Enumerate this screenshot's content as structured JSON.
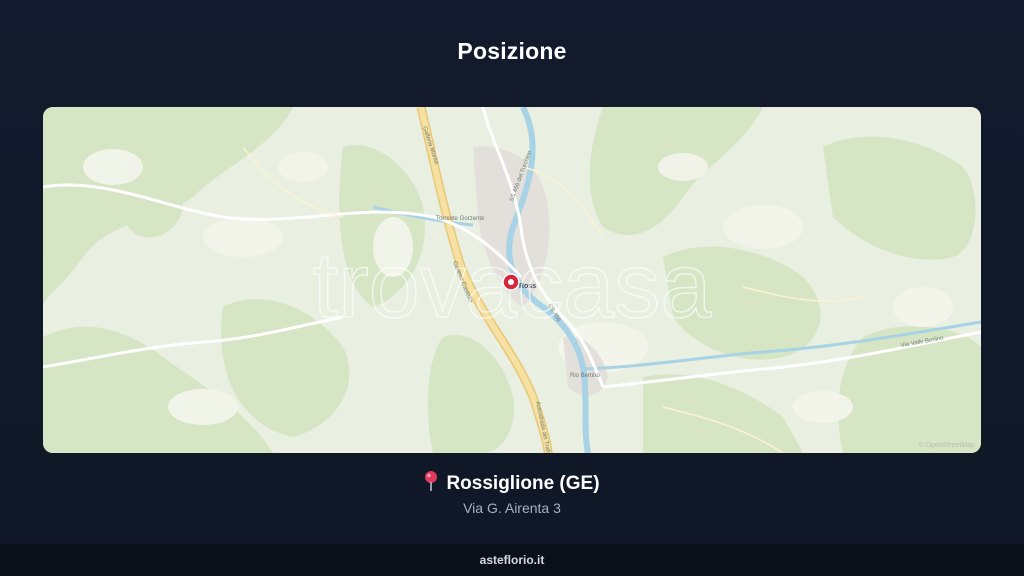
{
  "header": {
    "title": "Posizione"
  },
  "map": {
    "watermark": "trovacasa",
    "attribution": "© OpenStreetMap",
    "labels": {
      "gallery": "Galleria Morea",
      "road_castle": "Galleria Castello",
      "motorway": "Autostrada dei Trafori",
      "river_station": "Torrente Gorzente",
      "ss456": "SS 456 del Turchino",
      "ss456_b": "SS 456",
      "place_short": "Ross",
      "rio_bertino": "Rio Bertino",
      "valle_berlino": "Via Valle Berlino"
    },
    "colors": {
      "base": "#e9efe1",
      "forest": "#d7e6c6",
      "river": "#a9d3e6",
      "motorway": "#f1d893",
      "marker": "#d4283c"
    }
  },
  "location": {
    "pin_icon": "map-pin-icon",
    "name": "Rossiglione (GE)",
    "address": "Via G. Airenta 3"
  },
  "footer": {
    "site": "asteflorio.it"
  }
}
